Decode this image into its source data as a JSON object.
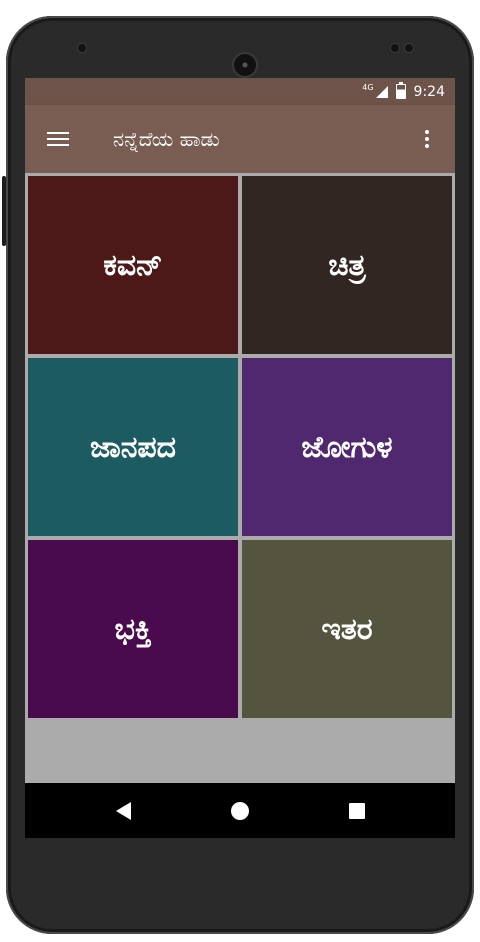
{
  "status_bar": {
    "network": "4G",
    "time": "9:24"
  },
  "toolbar": {
    "title": "ನನ್ನೆದೆಯ ಹಾಡು"
  },
  "tiles": [
    {
      "label": "ಕವನ್",
      "color": "#4d1818"
    },
    {
      "label": "ಚಿತ್ರ",
      "color": "#322622"
    },
    {
      "label": "ಜಾನಪದ",
      "color": "#1b5b61"
    },
    {
      "label": "ಜೋಗುಳ",
      "color": "#4f2870"
    },
    {
      "label": "ಭಕ್ತಿ",
      "color": "#4a0a4e"
    },
    {
      "label": "ಇತರ",
      "color": "#55543e"
    }
  ],
  "colors": {
    "status_bar": "#6d534a",
    "toolbar": "#795d52",
    "content_background": "#ababab"
  }
}
